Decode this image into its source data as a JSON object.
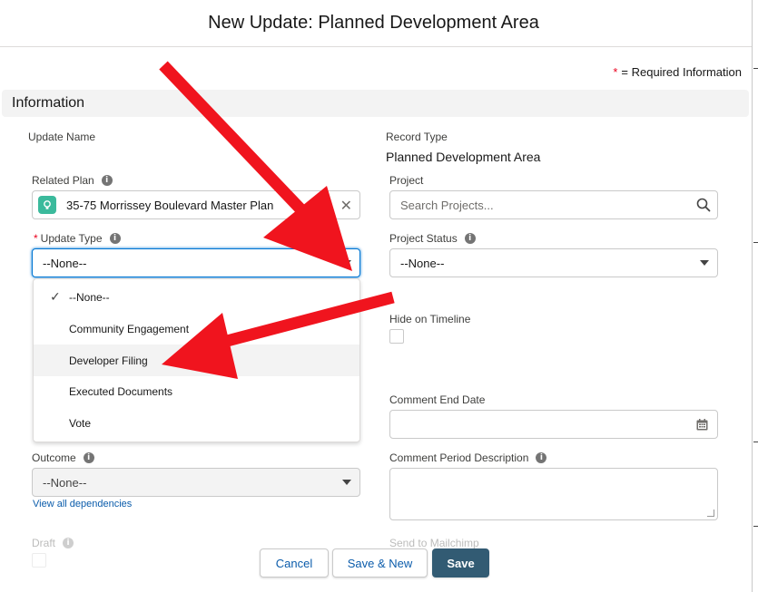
{
  "modal": {
    "title": "New Update: Planned Development Area"
  },
  "required_info": {
    "star": "*",
    "text": "= Required Information"
  },
  "section": {
    "title": "Information"
  },
  "fields": {
    "update_name": {
      "label": "Update Name"
    },
    "record_type": {
      "label": "Record Type",
      "value": "Planned Development Area"
    },
    "related_plan": {
      "label": "Related Plan",
      "value": "35-75 Morrissey Boulevard Master Plan"
    },
    "project": {
      "label": "Project",
      "placeholder": "Search Projects..."
    },
    "update_type": {
      "label": "Update Type",
      "required_mark": "*",
      "value": "--None--"
    },
    "project_status": {
      "label": "Project Status",
      "value": "--None--"
    },
    "hide_on_timeline": {
      "label": "Hide on Timeline",
      "checked": false
    },
    "comment_end_date": {
      "label": "Comment End Date",
      "value": ""
    },
    "outcome": {
      "label": "Outcome",
      "value": "--None--",
      "dependencies_link": "View all dependencies"
    },
    "comment_period_description": {
      "label": "Comment Period Description",
      "value": ""
    },
    "draft": {
      "label": "Draft",
      "checked": false
    },
    "send_to_mailchimp": {
      "label": "Send to Mailchimp"
    }
  },
  "update_type_options": [
    {
      "label": "--None--",
      "selected": true
    },
    {
      "label": "Community Engagement",
      "selected": false
    },
    {
      "label": "Developer Filing",
      "selected": false,
      "highlighted": true
    },
    {
      "label": "Executed Documents",
      "selected": false
    },
    {
      "label": "Vote",
      "selected": false
    }
  ],
  "footer": {
    "cancel_label": "Cancel",
    "save_new_label": "Save & New",
    "save_label": "Save"
  },
  "icons": {
    "info": "info-icon",
    "clear": "close-icon",
    "search": "search-icon",
    "calendar": "calendar-icon",
    "check": "check-icon",
    "plan": "lightbulb-icon"
  },
  "colors": {
    "annotation_arrow": "#f0141e",
    "brand_button": "#325b73",
    "focus_border": "#0176d3",
    "plan_icon": "#3bba9c",
    "required": "#ea001e"
  }
}
